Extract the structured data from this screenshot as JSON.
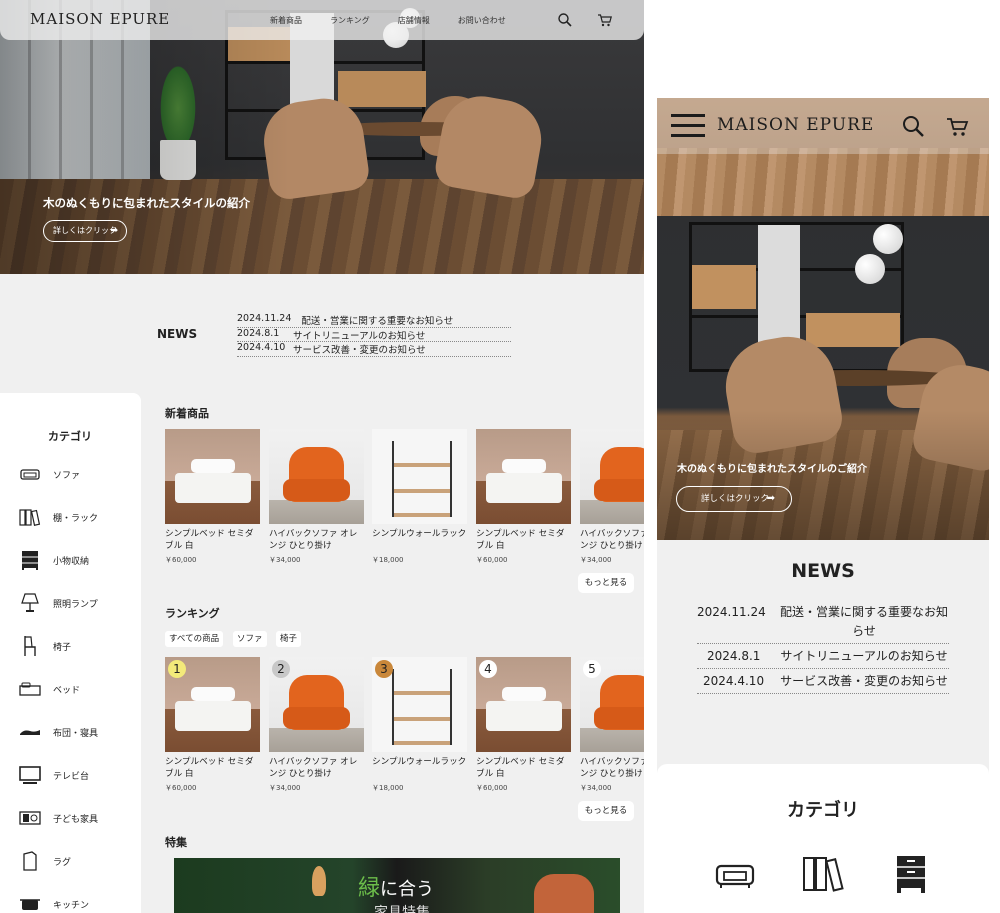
{
  "desktop": {
    "logo": "MAISON EPURE",
    "nav": [
      "新着商品",
      "ランキング",
      "店舗情報",
      "お問い合わせ"
    ],
    "icons": {
      "search": "search-icon",
      "cart": "cart-icon"
    },
    "hero": {
      "title": "木のぬくもりに包まれたスタイルの紹介",
      "button": "詳しくはクリック",
      "button_arrow": "➡"
    },
    "news": {
      "label": "NEWS",
      "items": [
        {
          "date": "2024.11.24",
          "text": "配送・営業に関する重要なお知らせ"
        },
        {
          "date": "2024.8.1",
          "text": "サイトリニューアルのお知らせ"
        },
        {
          "date": "2024.4.10",
          "text": "サービス改善・変更のお知らせ"
        }
      ]
    },
    "categories": {
      "title": "カテゴリ",
      "items": [
        "ソファ",
        "棚・ラック",
        "小物収納",
        "照明ランプ",
        "椅子",
        "ベッド",
        "布団・寝具",
        "テレビ台",
        "子ども家具",
        "ラグ",
        "キッチン"
      ]
    },
    "new_items": {
      "title": "新着商品",
      "more": "もっと見る",
      "products": [
        {
          "name": "シンプルベッド セミダブル 白",
          "price": "￥60,000",
          "image": "bed"
        },
        {
          "name": "ハイバックソファ オレンジ ひとり掛け",
          "price": "￥34,000",
          "image": "sofa"
        },
        {
          "name": "シンプルウォールラック",
          "price": "￥18,000",
          "image": "rack"
        },
        {
          "name": "シンプルベッド セミダブル 白",
          "price": "￥60,000",
          "image": "bed"
        },
        {
          "name": "ハイバックソファ オレンジ ひとり掛け",
          "price": "￥34,000",
          "image": "sofa"
        }
      ]
    },
    "ranking": {
      "title": "ランキング",
      "filters": [
        "すべての商品",
        "ソファ",
        "椅子"
      ],
      "more": "もっと見る",
      "products": [
        {
          "rank": "1",
          "name": "シンプルベッド セミダブル 白",
          "price": "￥60,000",
          "image": "bed",
          "badge_color": "#f3ea7a"
        },
        {
          "rank": "2",
          "name": "ハイバックソファ オレンジ ひとり掛け",
          "price": "￥34,000",
          "image": "sofa",
          "badge_color": "#c8c8c8"
        },
        {
          "rank": "3",
          "name": "シンプルウォールラック",
          "price": "￥18,000",
          "image": "rack",
          "badge_color": "#c9873a"
        },
        {
          "rank": "4",
          "name": "シンプルベッド セミダブル 白",
          "price": "￥60,000",
          "image": "bed",
          "badge_color": "#ffffff"
        },
        {
          "rank": "5",
          "name": "ハイバックソファ オレンジ ひとり掛け",
          "price": "￥34,000",
          "image": "sofa",
          "badge_color": "#ffffff"
        }
      ]
    },
    "feature": {
      "title": "特集",
      "banner_char": "緑",
      "banner_text": "に合う",
      "banner_text2": "家具特集"
    }
  },
  "mobile": {
    "logo": "MAISON EPURE",
    "icons": {
      "menu": "menu-icon",
      "search": "search-icon",
      "cart": "cart-icon"
    },
    "hero": {
      "title": "木のぬくもりに包まれたスタイルのご紹介",
      "button": "詳しくはクリック",
      "button_arrow": "➡"
    },
    "news": {
      "title": "NEWS",
      "items": [
        {
          "date": "2024.11.24",
          "text": "配送・営業に関する重要なお知らせ"
        },
        {
          "date": "2024.8.1",
          "text": "サイトリニューアルのお知らせ"
        },
        {
          "date": "2024.4.10",
          "text": "サービス改善・変更のお知らせ"
        }
      ]
    },
    "categories": {
      "title": "カテゴリ",
      "icons": [
        "sofa-icon",
        "shelf-icon",
        "drawer-icon"
      ]
    }
  }
}
